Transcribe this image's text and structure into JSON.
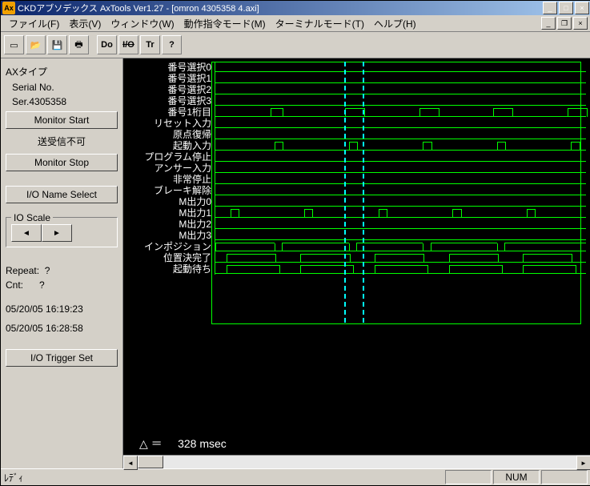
{
  "titlebar": {
    "icon_text": "Ax",
    "title": "CKDアブソデックス AxTools Ver1.27 - [omron 4305358 4.axi]"
  },
  "menu": {
    "file": "ファイル(F)",
    "view": "表示(V)",
    "window": "ウィンドウ(W)",
    "opmode": "動作指令モード(M)",
    "termmode": "ターミナルモード(T)",
    "help": "ヘルプ(H)"
  },
  "toolbar": {
    "new": "□",
    "open": "📂",
    "save": "💾",
    "print": "🖨",
    "do": "Do",
    "io": "I/O",
    "tr": "Tr",
    "help": "?"
  },
  "sidebar": {
    "type_label": "AXタイプ",
    "serial_label": "Serial No.",
    "serial_value": "Ser.4305358",
    "monitor_start": "Monitor Start",
    "txrx_status": "送受信不可",
    "monitor_stop": "Monitor Stop",
    "io_name_select": "I/O Name Select",
    "io_scale_title": "IO Scale",
    "repeat_label": "Repeat:",
    "repeat_value": "?",
    "cnt_label": "Cnt:",
    "cnt_value": "?",
    "time1": "05/20/05 16:19:23",
    "time2": "05/20/05 16:28:58",
    "io_trigger_set": "I/O Trigger Set"
  },
  "signals": [
    "番号選択0",
    "番号選択1",
    "番号選択2",
    "番号選択3",
    "番号1桁目",
    "リセット入力",
    "原点復帰",
    "起動入力",
    "プログラム停止",
    "アンサー入力",
    "非常停止",
    "ブレーキ解除",
    "M出力0",
    "M出力1",
    "M出力2",
    "M出力3",
    "インポジション",
    "位置決完了",
    "起動待ち"
  ],
  "delta": {
    "symbol": "△ ＝",
    "value": "328 msec"
  },
  "statusbar": {
    "ready": "ﾚﾃﾞｨ",
    "num": "NUM"
  },
  "chart_data": {
    "type": "timing-diagram",
    "x_unit": "msec",
    "cursor_delta_msec": 328,
    "cursor1_pct": 36,
    "cursor2_pct": 41,
    "signals": [
      {
        "name": "番号選択0",
        "transitions": []
      },
      {
        "name": "番号選択1",
        "transitions": []
      },
      {
        "name": "番号選択2",
        "transitions": []
      },
      {
        "name": "番号選択3",
        "transitions": []
      },
      {
        "name": "番号1桁目",
        "pulses_pct": [
          [
            15,
            18
          ],
          [
            35,
            40
          ],
          [
            55,
            60
          ],
          [
            75,
            80
          ],
          [
            95,
            100
          ]
        ]
      },
      {
        "name": "リセット入力",
        "transitions": []
      },
      {
        "name": "原点復帰",
        "transitions": []
      },
      {
        "name": "起動入力",
        "pulses_pct": [
          [
            16,
            18
          ],
          [
            36,
            38
          ],
          [
            56,
            58
          ],
          [
            76,
            78
          ],
          [
            96,
            98
          ]
        ]
      },
      {
        "name": "プログラム停止",
        "transitions": []
      },
      {
        "name": "アンサー入力",
        "transitions": []
      },
      {
        "name": "非常停止",
        "transitions": []
      },
      {
        "name": "ブレーキ解除",
        "transitions": []
      },
      {
        "name": "M出力0",
        "transitions": []
      },
      {
        "name": "M出力1",
        "pulses_pct": [
          [
            4,
            6
          ],
          [
            24,
            26
          ],
          [
            44,
            46
          ],
          [
            64,
            66
          ],
          [
            84,
            86
          ]
        ]
      },
      {
        "name": "M出力2",
        "transitions": []
      },
      {
        "name": "M出力3",
        "transitions": []
      },
      {
        "name": "インポジション",
        "steps_pct": [
          [
            0,
            16,
            1
          ],
          [
            16,
            18,
            0
          ],
          [
            18,
            36,
            1
          ],
          [
            36,
            38,
            0
          ],
          [
            38,
            56,
            1
          ],
          [
            56,
            58,
            0
          ],
          [
            58,
            76,
            1
          ],
          [
            76,
            78,
            0
          ],
          [
            78,
            100,
            1
          ]
        ]
      },
      {
        "name": "位置決完了",
        "pulses_pct": [
          [
            3,
            16
          ],
          [
            23,
            36
          ],
          [
            43,
            56
          ],
          [
            63,
            76
          ],
          [
            83,
            96
          ]
        ]
      },
      {
        "name": "起動待ち",
        "pulses_pct": [
          [
            3,
            17
          ],
          [
            23,
            37
          ],
          [
            43,
            57
          ],
          [
            63,
            77
          ],
          [
            83,
            97
          ]
        ]
      }
    ]
  }
}
